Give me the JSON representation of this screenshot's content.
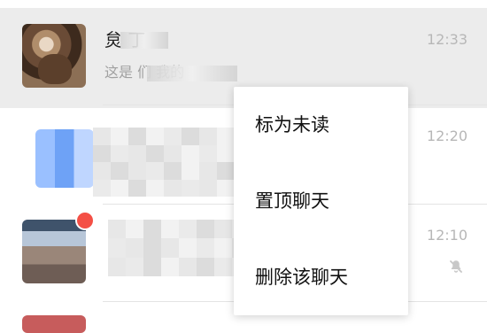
{
  "chats": [
    {
      "name": "炱 丁",
      "preview": "这是 们 我的",
      "time": "12:33",
      "selected": true
    },
    {
      "name": "",
      "preview": "",
      "time": "12:20",
      "selected": false
    },
    {
      "name": "",
      "preview": "",
      "time": "12:10",
      "selected": false,
      "unread": true,
      "muted": true
    }
  ],
  "context_menu": {
    "items": [
      {
        "label": "标为未读"
      },
      {
        "label": "置顶聊天"
      },
      {
        "label": "删除该聊天"
      }
    ]
  },
  "icons": {
    "mute": "bell-slash-icon"
  }
}
